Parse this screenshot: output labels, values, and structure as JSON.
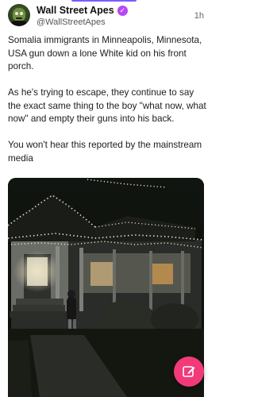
{
  "post": {
    "author_name": "Wall Street Apes",
    "handle": "@WallStreetApes",
    "timestamp": "1h",
    "paragraphs": [
      "Somalia immigrants in Minneapolis, Minnesota, USA gun down a lone White kid on his front porch.",
      "As he's trying to escape, they continue to say the exact same thing to the boy \"what now, what now\" and empty their guns into his back.",
      "You won't hear this reported by the mainstream media"
    ]
  },
  "icons": {
    "verified": "verified-badge-icon",
    "compose": "compose-edit-icon",
    "avatar": "author-avatar"
  },
  "colors": {
    "accent": "#7c5cff",
    "verified": "#b847f5",
    "fab": "#f23a7a"
  }
}
